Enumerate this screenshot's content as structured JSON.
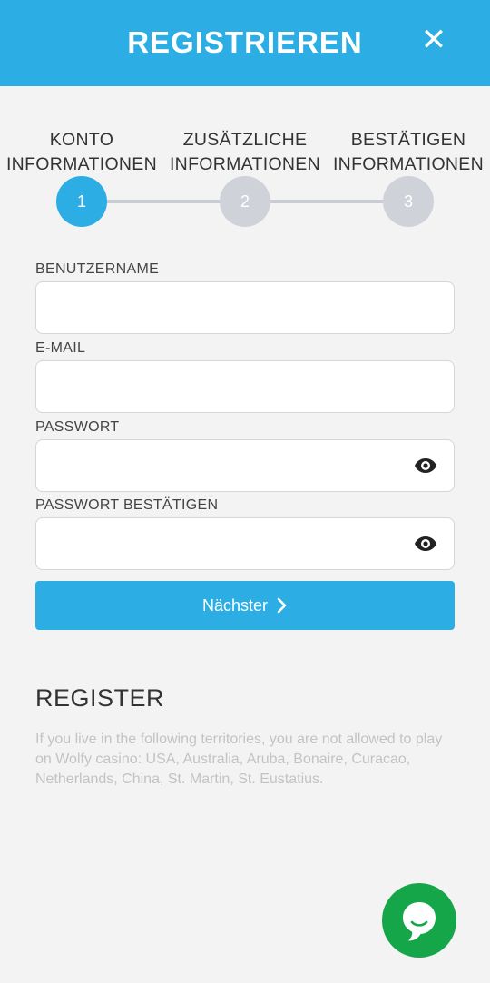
{
  "header": {
    "title": "REGISTRIEREN",
    "close_label": "✕"
  },
  "steps": [
    {
      "line1": "KONTO",
      "line2": "INFORMATIONEN",
      "number": "1",
      "active": true
    },
    {
      "line1": "ZUSÄTZLICHE",
      "line2": "INFORMATIONEN",
      "number": "2",
      "active": false
    },
    {
      "line1": "BESTÄTIGEN",
      "line2": "INFORMATIONEN",
      "number": "3",
      "active": false
    }
  ],
  "form": {
    "username_label": "BENUTZERNAME",
    "username_value": "",
    "email_label": "E-MAIL",
    "email_value": "",
    "password_label": "PASSWORT",
    "password_value": "",
    "password_confirm_label": "PASSWORT BESTÄTIGEN",
    "password_confirm_value": "",
    "next_label": "Nächster"
  },
  "info": {
    "title": "REGISTER",
    "text": "If you live in the following territories, you are not allowed to play on Wolfy casino: USA, Australia, Aruba, Bonaire, Curacao, Netherlands, China, St. Martin, St. Eustatius."
  },
  "colors": {
    "accent": "#2caee4",
    "chat": "#16a64a",
    "inactive_step": "#cfd2d8",
    "background": "#f3f3f3"
  },
  "icons": {
    "close": "close-icon",
    "eye": "eye-icon",
    "chevron": "chevron-right-icon",
    "chat": "chat-bubble-icon"
  }
}
